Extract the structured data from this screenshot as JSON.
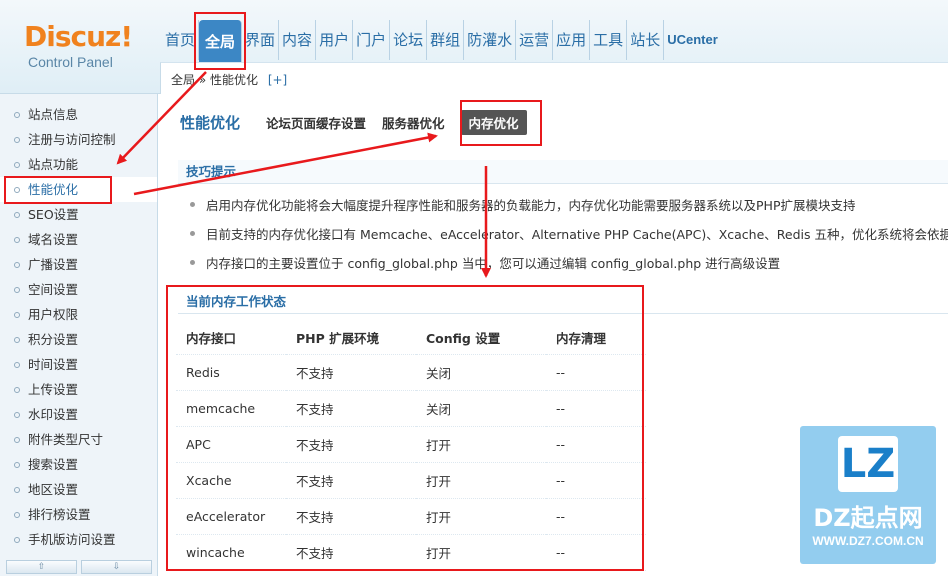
{
  "header": {
    "brand": "Discuz!",
    "subtitle": "Control Panel",
    "nav": [
      {
        "label": "首页",
        "active": false
      },
      {
        "label": "全局",
        "active": true
      },
      {
        "label": "界面",
        "active": false
      },
      {
        "label": "内容",
        "active": false
      },
      {
        "label": "用户",
        "active": false
      },
      {
        "label": "门户",
        "active": false
      },
      {
        "label": "论坛",
        "active": false
      },
      {
        "label": "群组",
        "active": false
      },
      {
        "label": "防灌水",
        "active": false
      },
      {
        "label": "运营",
        "active": false
      },
      {
        "label": "应用",
        "active": false
      },
      {
        "label": "工具",
        "active": false
      },
      {
        "label": "站长",
        "active": false
      },
      {
        "label": "UCenter",
        "active": false
      }
    ]
  },
  "breadcrumb": {
    "path": "全局 » 性能优化",
    "add": "[+]"
  },
  "sidebar": {
    "items": [
      {
        "label": "站点信息"
      },
      {
        "label": "注册与访问控制"
      },
      {
        "label": "站点功能"
      },
      {
        "label": "性能优化"
      },
      {
        "label": "SEO设置"
      },
      {
        "label": "域名设置"
      },
      {
        "label": "广播设置"
      },
      {
        "label": "空间设置"
      },
      {
        "label": "用户权限"
      },
      {
        "label": "积分设置"
      },
      {
        "label": "时间设置"
      },
      {
        "label": "上传设置"
      },
      {
        "label": "水印设置"
      },
      {
        "label": "附件类型尺寸"
      },
      {
        "label": "搜索设置"
      },
      {
        "label": "地区设置"
      },
      {
        "label": "排行榜设置"
      },
      {
        "label": "手机版访问设置"
      }
    ],
    "scroll_up": "⇧",
    "scroll_down": "⇩"
  },
  "main": {
    "title": "性能优化",
    "tabs": [
      {
        "label": "论坛页面缓存设置",
        "active": false
      },
      {
        "label": "服务器优化",
        "active": false
      },
      {
        "label": "内存优化",
        "active": true
      }
    ],
    "tips_title": "技巧提示",
    "tips": [
      "启用内存优化功能将会大幅度提升程序性能和服务器的负载能力，内存优化功能需要服务器系统以及PHP扩展模块支持",
      "目前支持的内存优化接口有 Memcache、eAccelerator、Alternative PHP Cache(APC)、Xcache、Redis 五种，优化系统将会依据当",
      "内存接口的主要设置位于 config_global.php 当中，您可以通过编辑 config_global.php 进行高级设置"
    ],
    "status_title": "当前内存工作状态",
    "table": {
      "headers": [
        "内存接口",
        "PHP 扩展环境",
        "Config 设置",
        "内存清理"
      ],
      "rows": [
        [
          "Redis",
          "不支持",
          "关闭",
          "--"
        ],
        [
          "memcache",
          "不支持",
          "关闭",
          "--"
        ],
        [
          "APC",
          "不支持",
          "打开",
          "--"
        ],
        [
          "Xcache",
          "不支持",
          "打开",
          "--"
        ],
        [
          "eAccelerator",
          "不支持",
          "打开",
          "--"
        ],
        [
          "wincache",
          "不支持",
          "打开",
          "--"
        ]
      ]
    }
  },
  "watermark": {
    "logo": "LZ",
    "name": "DZ起点网",
    "url": "WWW.DZ7.COM.CN"
  },
  "colors": {
    "accent": "#2a6ea6",
    "brand": "#f0821e",
    "annotation": "#e8191c"
  }
}
